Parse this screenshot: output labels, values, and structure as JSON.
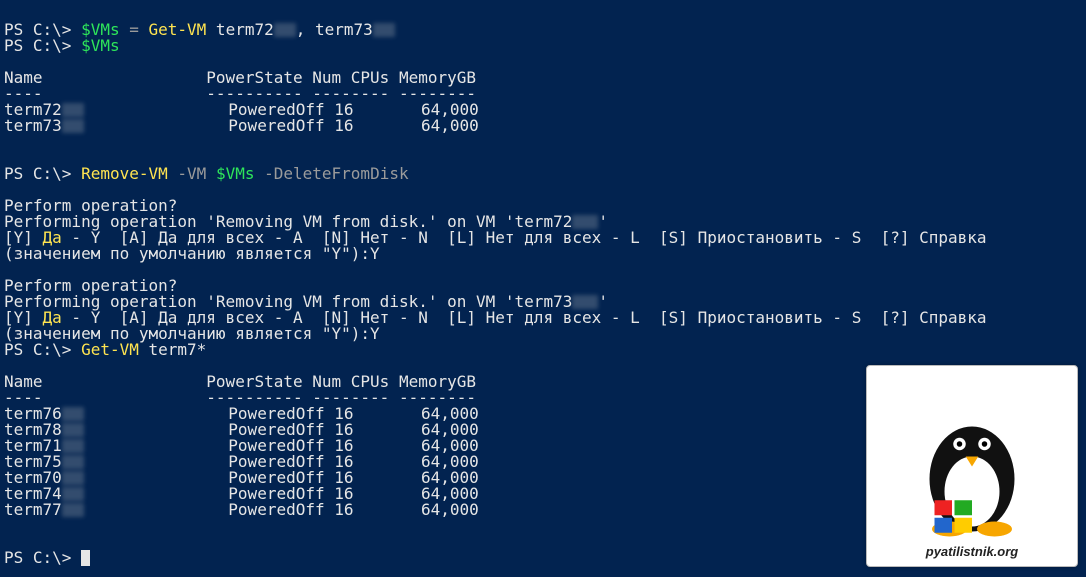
{
  "ps_prompt": "PS C:\\> ",
  "lines": {
    "l1_var": "$VMs",
    "l1_eq": " = ",
    "l1_cmd": "Get-VM",
    "l1_args_a": " term72",
    "l1_args_b": ", term73",
    "l2_var": "$VMs",
    "hdr": "Name                 PowerState Num CPUs MemoryGB",
    "sep": "----                 ---------- -------- --------",
    "row1a": "term72",
    "row1b": "               PoweredOff 16       64,000",
    "row2a": "term73",
    "row2b": "               PoweredOff 16       64,000",
    "l3_cmd": "Remove-VM",
    "l3_p1": " -VM ",
    "l3_var": "$VMs",
    "l3_p2": " -DeleteFromDisk",
    "op_q": "Perform operation?",
    "op_m1a": "Performing operation 'Removing VM from disk.' on VM 'term72",
    "op_m1b": "'",
    "choice_a": "[Y] ",
    "choice_yes": "Да",
    "choice_rest": " - Y  [A] Да для всех - A  [N] Нет - N  [L] Нет для всех - L  [S] Приостановить - S  [?] Справка",
    "choice_def": "(значением по умолчанию является \"Y\"):Y",
    "op_m2a": "Performing operation 'Removing VM from disk.' on VM 'term73",
    "op_m2b": "'",
    "l4_cmd": "Get-VM",
    "l4_arg": " term7*",
    "t2r1a": "term76",
    "t2r1b": "               PoweredOff 16       64,000",
    "t2r2a": "term78",
    "t2r2b": "               PoweredOff 16       64,000",
    "t2r3a": "term71",
    "t2r3b": "               PoweredOff 16       64,000",
    "t2r4a": "term75",
    "t2r4b": "               PoweredOff 16       64,000",
    "t2r5a": "term70",
    "t2r5b": "               PoweredOff 16       64,000",
    "t2r6a": "term74",
    "t2r6b": "               PoweredOff 16       64,000",
    "t2r7a": "term77",
    "t2r7b": "               PoweredOff 16       64,000"
  },
  "logo_text": "pyatilistnik.org"
}
